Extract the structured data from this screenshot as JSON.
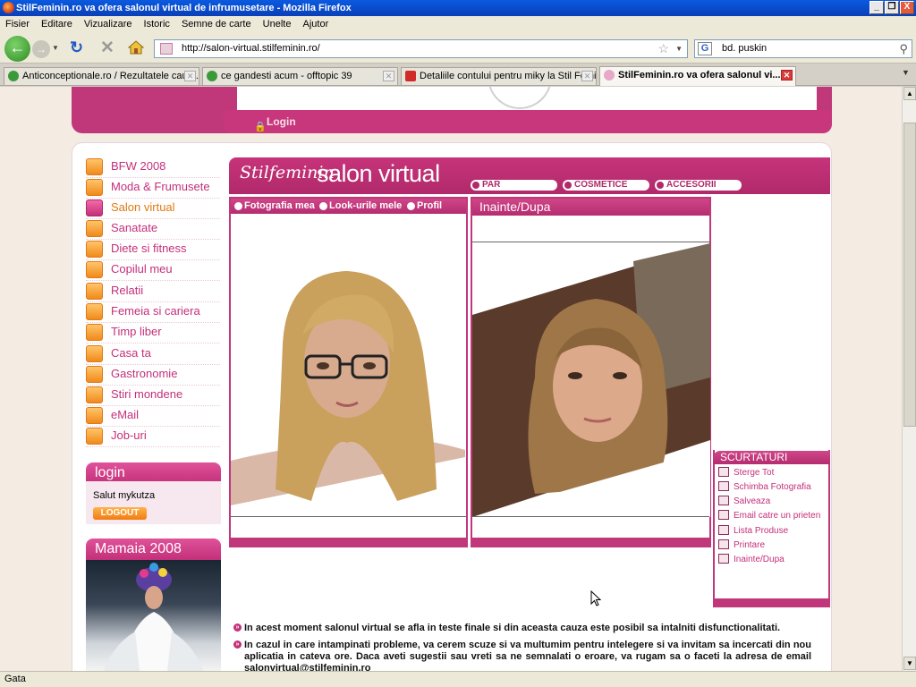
{
  "window": {
    "title": "StilFeminin.ro va ofera salonul virtual de infrumusetare - Mozilla Firefox",
    "minimize": "_",
    "restore": "❐",
    "close": "X"
  },
  "menubar": [
    "Fisier",
    "Editare",
    "Vizualizare",
    "Istoric",
    "Semne de carte",
    "Unelte",
    "Ajutor"
  ],
  "navbar": {
    "url": "http://salon-virtual.stilfeminin.ro/",
    "search_value": "bd. puskin",
    "search_engine_icon": "google-icon"
  },
  "tabs": [
    {
      "label": "Anticonceptionale.ro / Rezultatele caut...",
      "active": false
    },
    {
      "label": "ce gandesti acum - offtopic 39",
      "active": false
    },
    {
      "label": "Detaliile contului pentru miky la Stil Femi...",
      "active": false
    },
    {
      "label": "StilFeminin.ro va ofera salonul vi...",
      "active": true
    }
  ],
  "status": "Gata",
  "page": {
    "top_login": "Login",
    "nav": [
      {
        "label": "BFW 2008",
        "icon": "runway-icon"
      },
      {
        "label": "Moda & Frumusete",
        "icon": "lips-icon"
      },
      {
        "label": "Salon virtual",
        "icon": "eye-icon"
      },
      {
        "label": "Sanatate",
        "icon": "health-icon"
      },
      {
        "label": "Diete si fitness",
        "icon": "fitness-icon"
      },
      {
        "label": "Copilul meu",
        "icon": "child-icon"
      },
      {
        "label": "Relatii",
        "icon": "rings-icon"
      },
      {
        "label": "Femeia si cariera",
        "icon": "flower-icon"
      },
      {
        "label": "Timp liber",
        "icon": "leisure-icon"
      },
      {
        "label": "Casa ta",
        "icon": "house-icon"
      },
      {
        "label": "Gastronomie",
        "icon": "cooking-icon"
      },
      {
        "label": "Stiri mondene",
        "icon": "news-icon"
      },
      {
        "label": "eMail",
        "icon": "envelope-icon"
      },
      {
        "label": "Job-uri",
        "icon": "job-icon"
      }
    ],
    "login_box": {
      "title": "login",
      "greeting": "Salut mykutza",
      "logout": "LOGOUT"
    },
    "mamaia_box": {
      "title": "Mamaia 2008"
    },
    "salon": {
      "logo": "Stilfeminin",
      "title": "salon virtual",
      "tabs": [
        "PAR",
        "COSMETICE",
        "ACCESORII"
      ]
    },
    "panel_left": {
      "tabs": [
        "Fotografia mea",
        "Look-urile mele",
        "Profil"
      ]
    },
    "panel_right": {
      "title": "Inainte/Dupa"
    },
    "shortcuts": {
      "title": "SCURTATURI",
      "items": [
        {
          "label": "Sterge Tot",
          "icon": "undo-arrow-icon"
        },
        {
          "label": "Schimba Fotografia",
          "icon": "camera-icon"
        },
        {
          "label": "Salveaza",
          "icon": "save-icon"
        },
        {
          "label": "Email catre un prieten",
          "icon": "envelope-icon"
        },
        {
          "label": "Lista Produse",
          "icon": "list-icon"
        },
        {
          "label": "Printare",
          "icon": "printer-icon"
        },
        {
          "label": "Inainte/Dupa",
          "icon": "compare-icon"
        }
      ]
    },
    "notices": [
      "In acest moment salonul virtual se afla in teste finale si din aceasta cauza este posibil sa intalniti disfunctionalitati.",
      "In cazul in care intampinati probleme, va cerem scuze si va multumim pentru intelegere si va invitam sa incercati din nou aplicatia in cateva ore. Daca aveti sugestii sau vreti sa ne semnalati o eroare, va rugam sa o faceti la adresa de email salonvirtual@stilfeminin.ro"
    ]
  },
  "colors": {
    "brand_pink": "#c0377a",
    "accent_orange": "#f08a1c"
  }
}
